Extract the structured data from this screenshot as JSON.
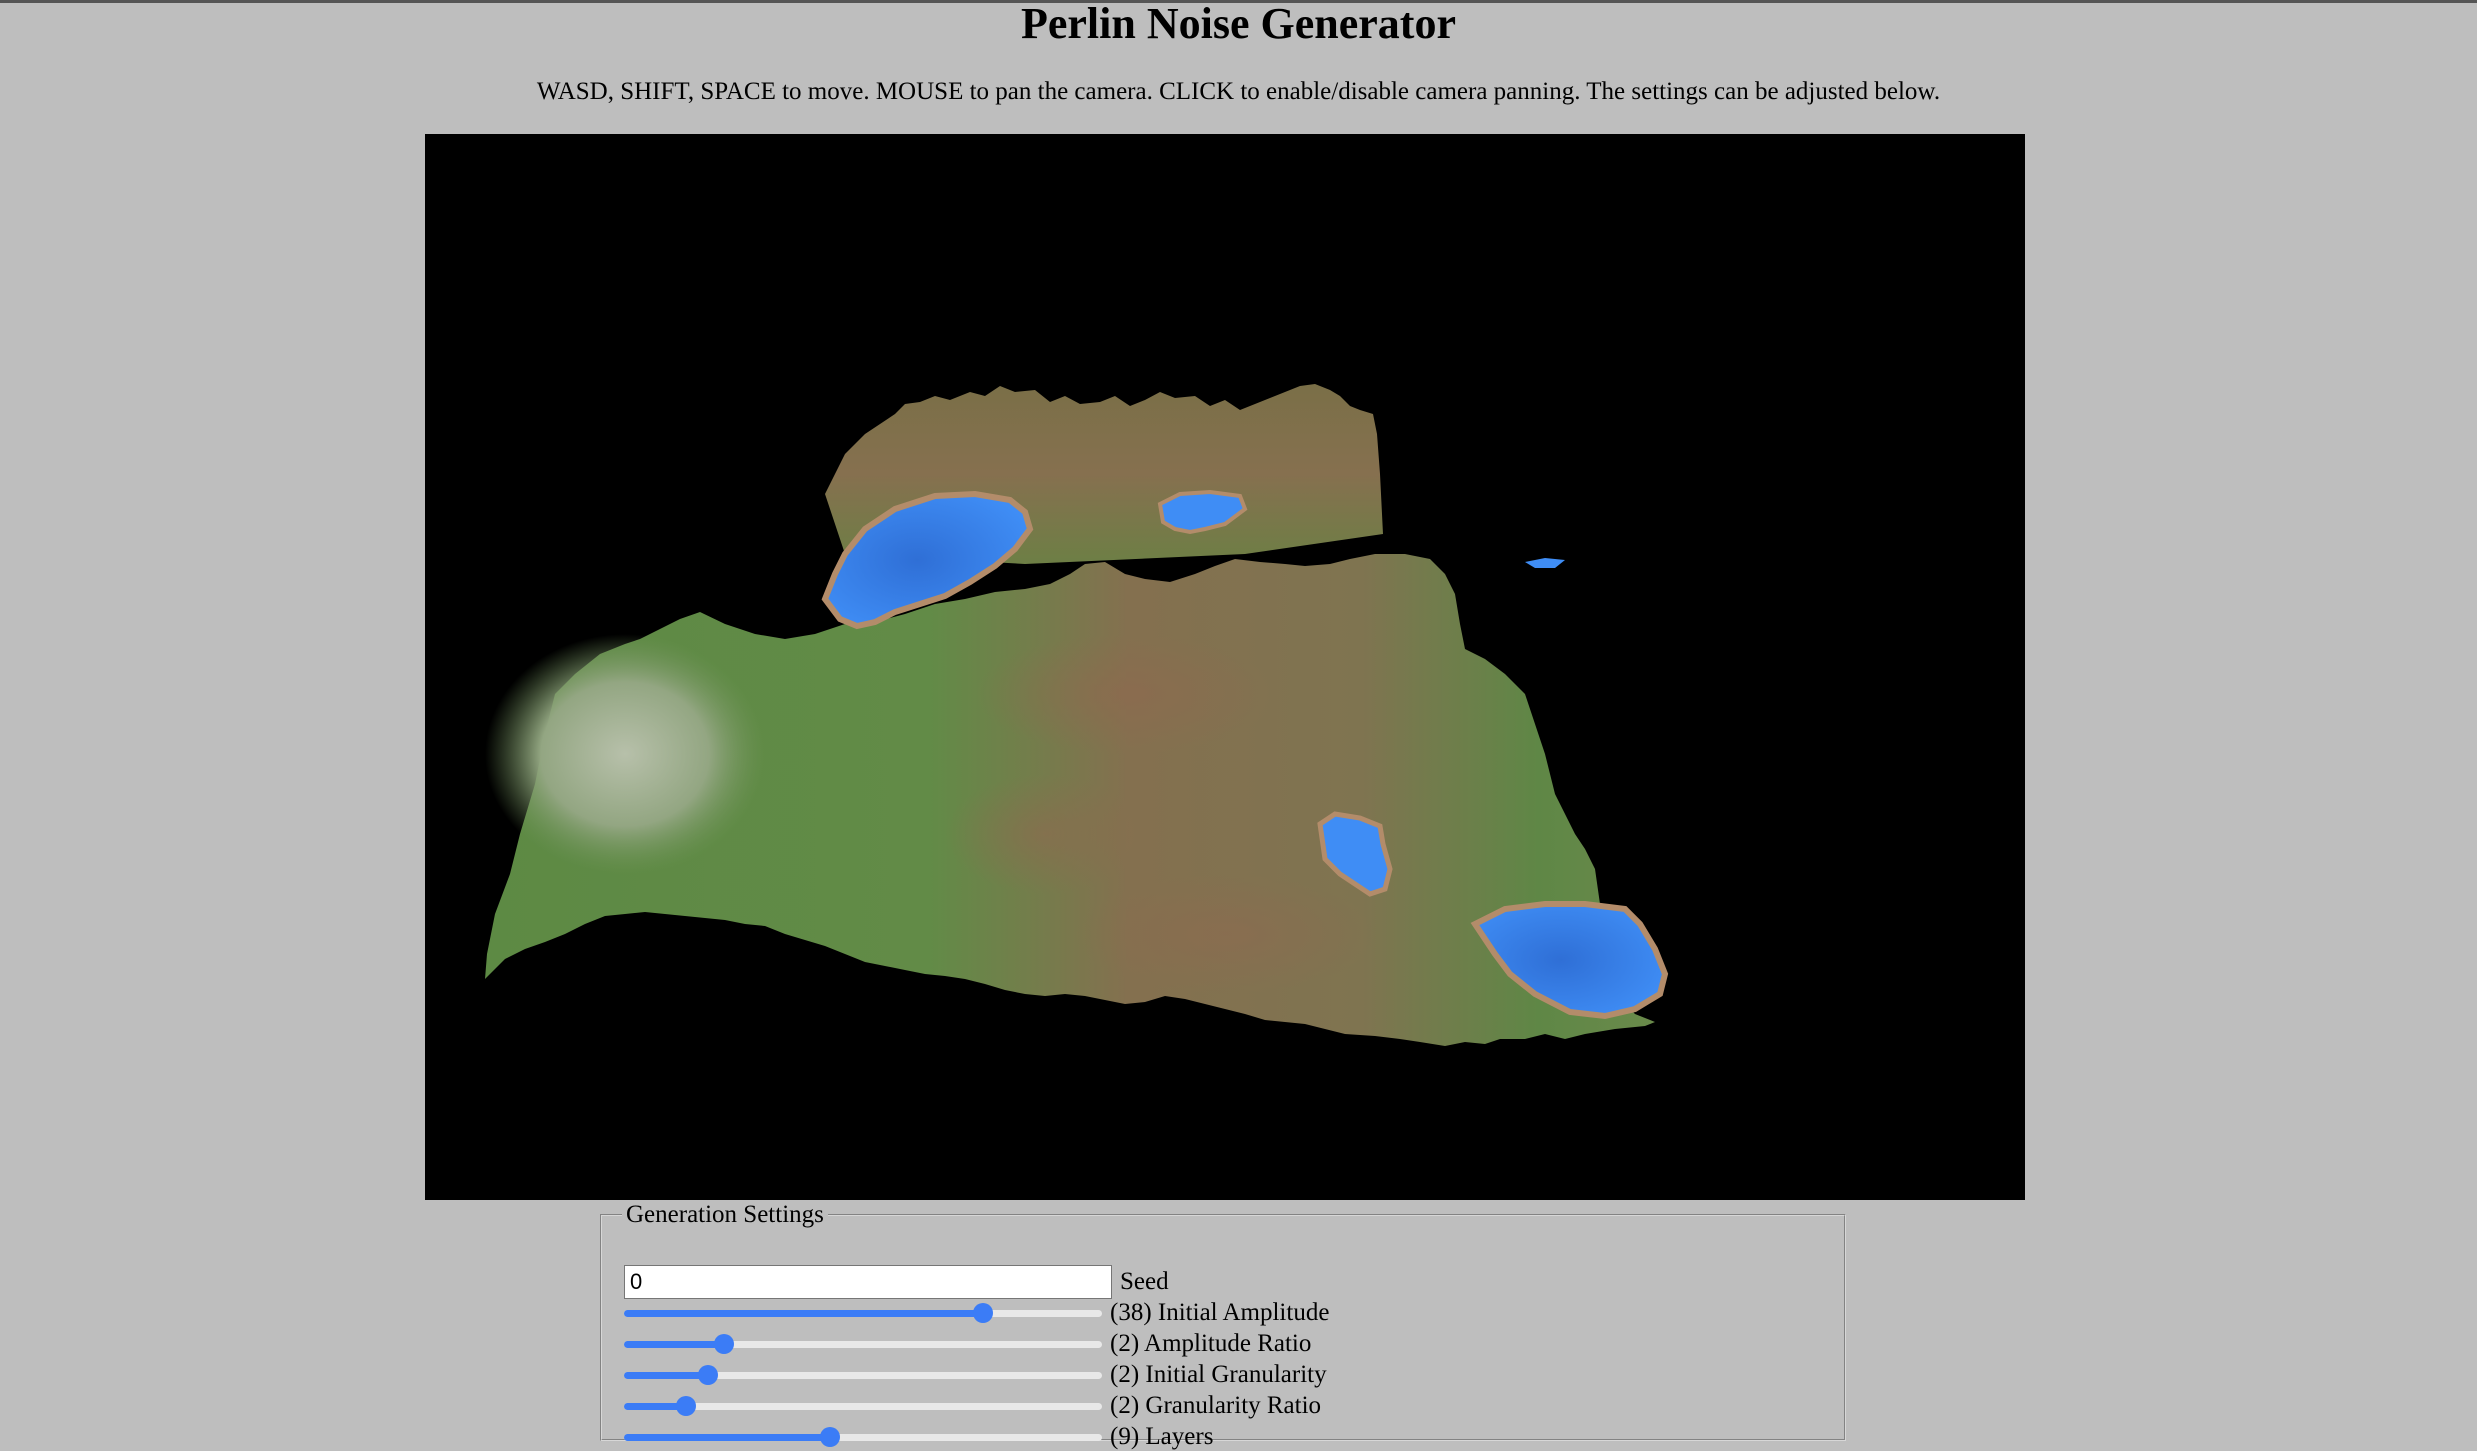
{
  "title": "Perlin Noise Generator",
  "instructions": "WASD, SHIFT, SPACE to move. MOUSE to pan the camera. CLICK to enable/disable camera panning. The settings can be adjusted below.",
  "settings": {
    "legend": "Generation Settings",
    "seed": {
      "value": "0",
      "label": "Seed"
    },
    "sliders": [
      {
        "id": "initial-amplitude",
        "label": "(38) Initial Amplitude",
        "fraction": 0.75
      },
      {
        "id": "amplitude-ratio",
        "label": "(2) Amplitude Ratio",
        "fraction": 0.21
      },
      {
        "id": "initial-granularity",
        "label": "(2) Initial Granularity",
        "fraction": 0.175
      },
      {
        "id": "granularity-ratio",
        "label": "(2) Granularity Ratio",
        "fraction": 0.13
      },
      {
        "id": "layers",
        "label": "(9) Layers",
        "fraction": 0.43
      }
    ]
  },
  "colors": {
    "page_background": "#bebebe",
    "viewport_background": "#000000",
    "slider_accent": "#3b7cf6",
    "terrain_grass": "#5f8a45",
    "terrain_dirt": "#8b6a4c",
    "terrain_water": "#3f8df5",
    "terrain_snow": "#a9b59c"
  }
}
